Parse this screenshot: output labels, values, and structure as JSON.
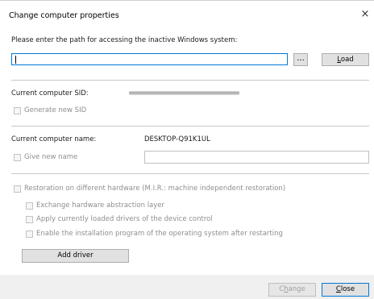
{
  "dialog": {
    "title": "Change computer properties",
    "close_glyph": "×"
  },
  "path_section": {
    "prompt": "Please enter the path for accessing the inactive Windows system:",
    "path_value": "",
    "browse_label": "...",
    "load_label_mnemonic": "L",
    "load_label_rest": "oad"
  },
  "sid_section": {
    "label": "Current computer SID:",
    "generate_new_sid_label": "Generate new SID",
    "generate_new_sid_checked": false
  },
  "name_section": {
    "label": "Current computer name:",
    "current_name": "DESKTOP-Q91K1UL",
    "give_new_name_label": "Give new name",
    "give_new_name_checked": false,
    "new_name_value": ""
  },
  "hardware_section": {
    "restoration_label": "Restoration on different hardware (M.I.R.: machine independent restoration)",
    "options": [
      "Exchange hardware abstraction layer",
      "Apply currently loaded drivers of the device control",
      "Enable the installation program of the operating system after restarting"
    ],
    "add_driver_label": "Add driver"
  },
  "footer": {
    "change_label_pre": "C",
    "change_label_mnemonic": "h",
    "change_label_rest": "ange",
    "close_label_mnemonic": "C",
    "close_label_rest": "lose"
  },
  "icons": {
    "close": "close-icon"
  }
}
